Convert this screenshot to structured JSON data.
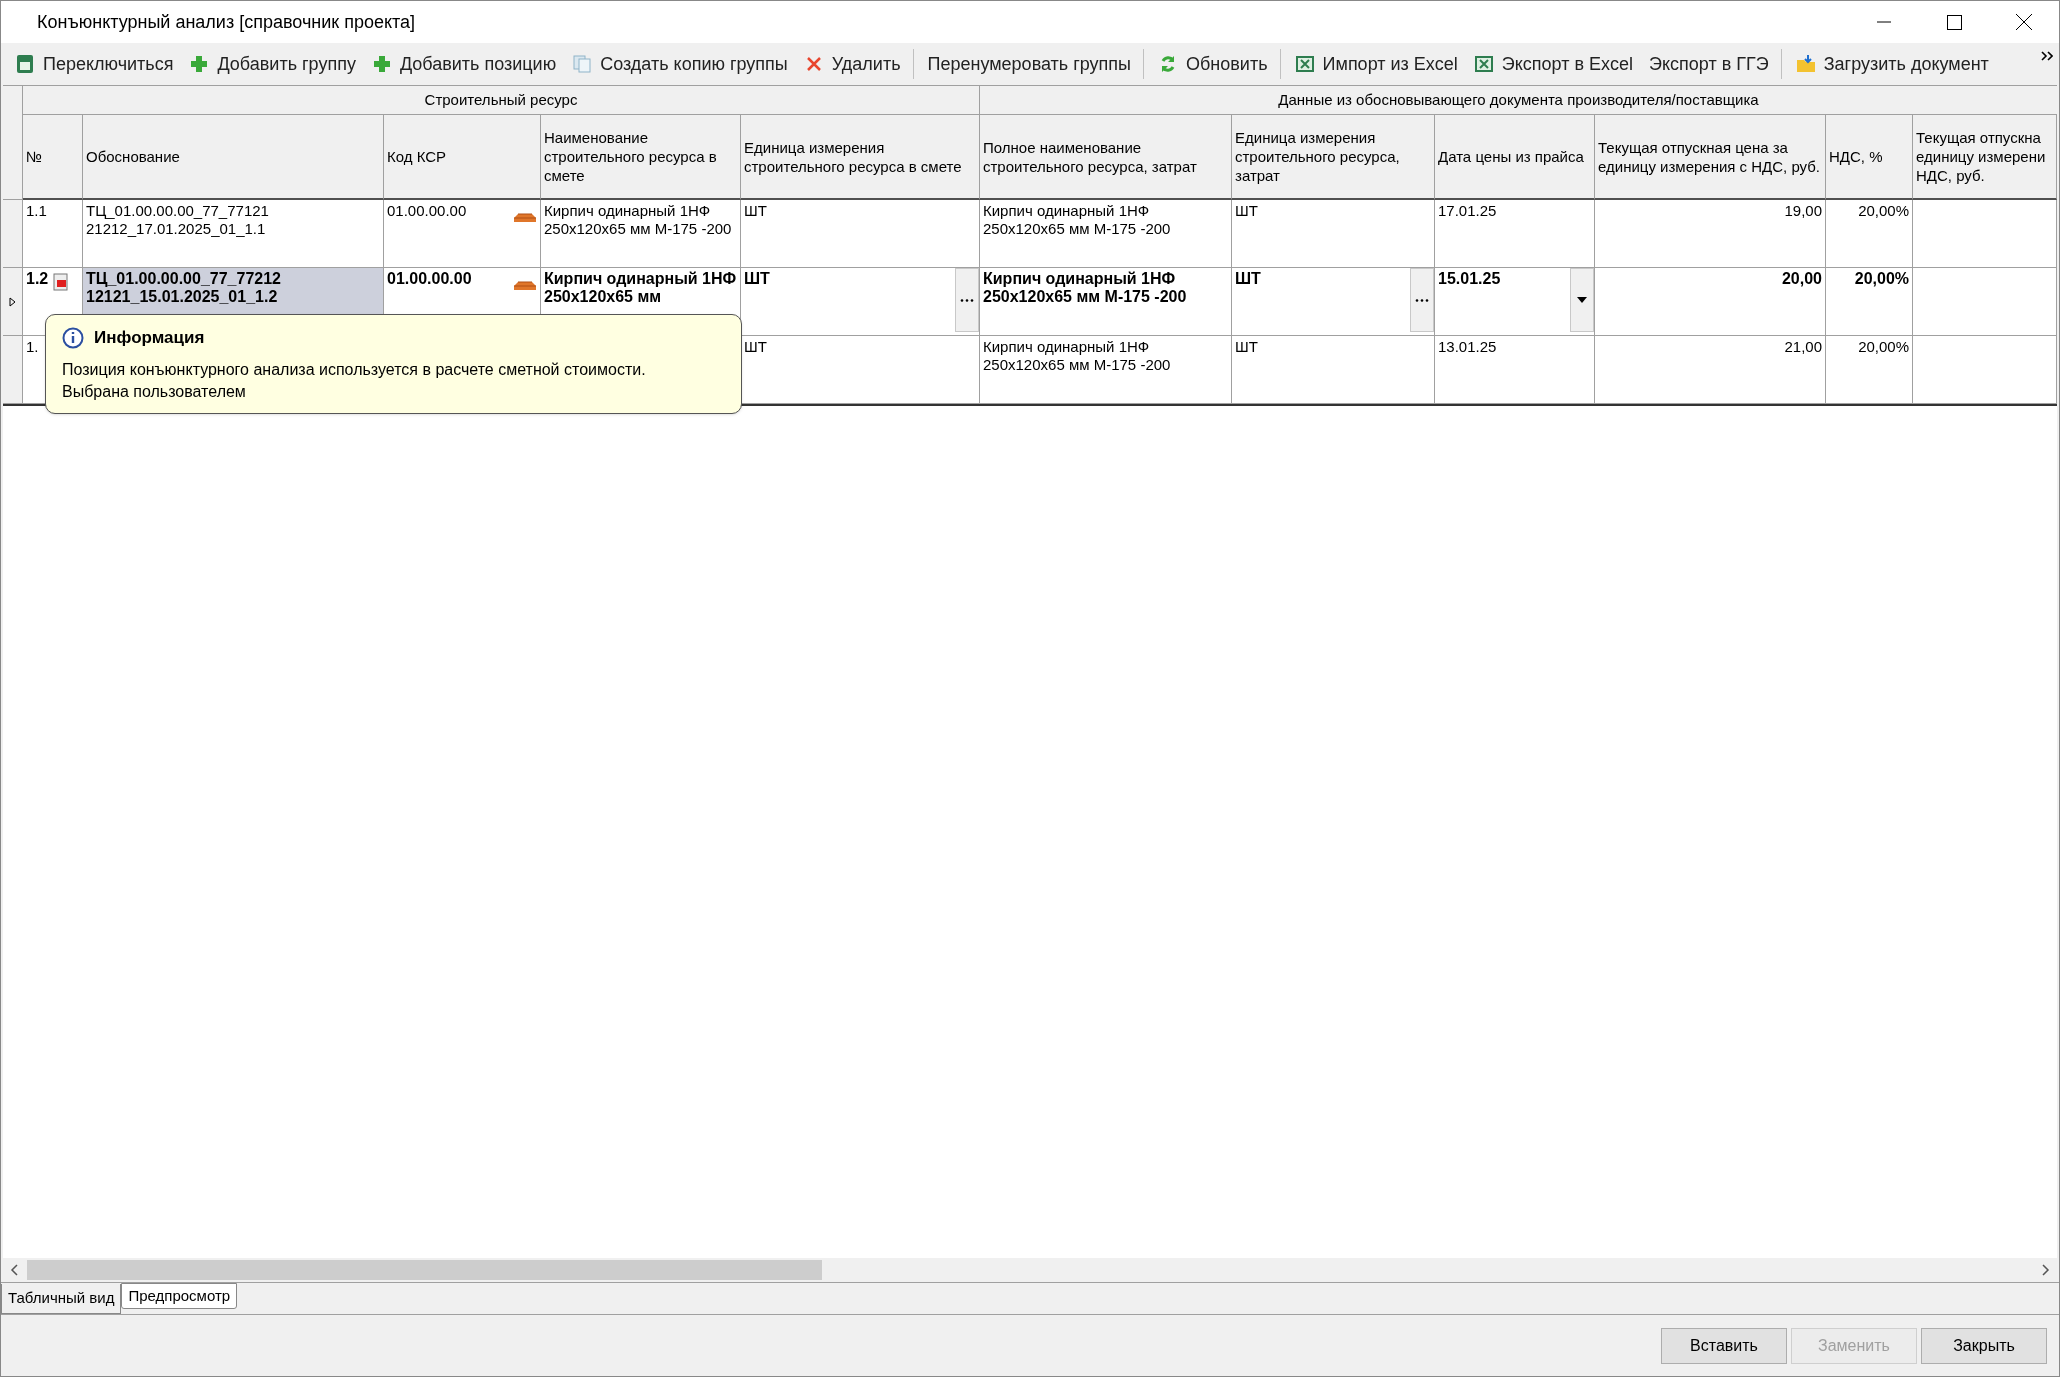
{
  "window": {
    "title": "Конъюнктурный анализ [справочник проекта]"
  },
  "toolbar": {
    "groups": [
      [
        "Переключиться",
        "Добавить группу",
        "Добавить позицию",
        "Создать копию группы",
        "Удалить"
      ],
      [
        "Перенумеровать группы"
      ],
      [
        "Обновить"
      ],
      [
        "Импорт из Excel",
        "Экспорт в Excel",
        "Экспорт в ГГЭ"
      ],
      [
        "Загрузить документ"
      ]
    ]
  },
  "table": {
    "group_headers": [
      "Строительный ресурс",
      "Данные из обосновывающего документа производителя/поставщика"
    ],
    "columns": [
      "№",
      "Обоснование",
      "Код КСР",
      "Наименование строительного ресурса в смете",
      "Единица измерения строительного ресурса в смете",
      "Полное наименование строительного ресурса, затрат",
      "Единица измерения строительного ресурса, затрат",
      "Дата цены из прайса",
      "Текущая отпускная цена за единицу измерения с НДС, руб.",
      "НДС, %",
      "Текущая отпускна\nединицу измерени\nНДС, руб."
    ],
    "rows": [
      {
        "selected": false,
        "in_estimate": false,
        "cells": {
          "no": "1.1",
          "basis": "ТЦ_01.00.00.00_77_77121 21212_17.01.2025_01_1.1",
          "ksr_code": "01.00.00.00",
          "name": "Кирпич одинарный 1НФ 250x120x65 мм М-175 -200",
          "unit": "ШТ",
          "full_name": "Кирпич одинарный 1НФ 250x120x65 мм М-175 -200",
          "unit_2": "ШТ",
          "price_date": "17.01.25",
          "price": "19,00",
          "vat": "20,00%"
        }
      },
      {
        "selected": true,
        "in_estimate": true,
        "cells": {
          "no": "1.2",
          "basis": "ТЦ_01.00.00.00_77_77212 12121_15.01.2025_01_1.2",
          "ksr_code": "01.00.00.00",
          "name": "Кирпич одинарный 1НФ 250x120x65 мм",
          "unit": "ШТ",
          "full_name": "Кирпич одинарный 1НФ 250x120x65 мм М-175 -200",
          "unit_2": "ШТ",
          "price_date": "15.01.25",
          "price": "20,00",
          "vat": "20,00%"
        }
      },
      {
        "selected": false,
        "in_estimate": false,
        "cells": {
          "no": "1.",
          "unit": "ШТ",
          "full_name": "Кирпич одинарный 1НФ 250x120x65 мм М-175 -200",
          "unit_2": "ШТ",
          "price_date": "13.01.25",
          "price": "21,00",
          "vat": "20,00%"
        }
      }
    ]
  },
  "tooltip": {
    "title": "Информация",
    "text": "Позиция конъюнктурного анализа используется в расчете сметной стоимости.\nВыбрана пользователем"
  },
  "view_tabs": [
    {
      "label": "Табличный вид",
      "selected": true
    },
    {
      "label": "Предпросмотр",
      "selected": false
    }
  ],
  "buttons": [
    {
      "label": "Вставить",
      "disabled": false
    },
    {
      "label": "Заменить",
      "disabled": true
    },
    {
      "label": "Закрыть",
      "disabled": false
    }
  ]
}
